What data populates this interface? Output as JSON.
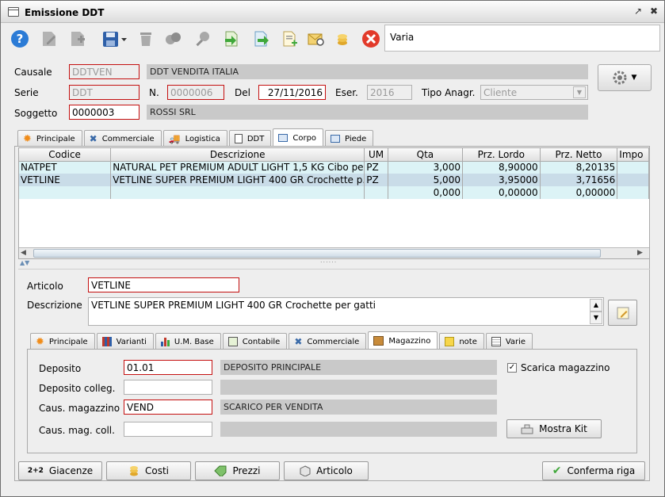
{
  "window": {
    "title": "Emissione DDT"
  },
  "toolbar": {
    "varia": "Varia"
  },
  "header": {
    "causale_label": "Causale",
    "causale_code": "DDTVEN",
    "causale_desc": "DDT VENDITA ITALIA",
    "serie_label": "Serie",
    "serie_value": "DDT",
    "n_label": "N.",
    "n_value": "0000006",
    "del_label": "Del",
    "del_value": "27/11/2016",
    "eser_label": "Eser.",
    "eser_value": "2016",
    "tipo_label": "Tipo Anagr.",
    "tipo_value": "Cliente",
    "soggetto_label": "Soggetto",
    "soggetto_code": "0000003",
    "soggetto_desc": "ROSSI SRL"
  },
  "main_tabs": [
    "Principale",
    "Commerciale",
    "Logistica",
    "DDT",
    "Corpo",
    "Piede"
  ],
  "grid": {
    "columns": [
      "Codice",
      "Descrizione",
      "UM",
      "Qta",
      "Prz. Lordo",
      "Prz. Netto",
      "Impo"
    ],
    "rows": [
      [
        "NATPET",
        "NATURAL PET PREMIUM ADULT LIGHT 1,5 KG Cibo pe...",
        "PZ",
        "3,000",
        "8,90000",
        "8,20135",
        ""
      ],
      [
        "VETLINE",
        "VETLINE SUPER PREMIUM LIGHT 400 GR Crochette p...",
        "PZ",
        "5,000",
        "3,95000",
        "3,71656",
        ""
      ],
      [
        "",
        "",
        "",
        "0,000",
        "0,00000",
        "0,00000",
        ""
      ]
    ]
  },
  "detail": {
    "articolo_label": "Articolo",
    "articolo_value": "VETLINE",
    "descrizione_label": "Descrizione",
    "descrizione_value": "VETLINE SUPER PREMIUM LIGHT 400 GR Crochette per gatti"
  },
  "sub_tabs": [
    "Principale",
    "Varianti",
    "U.M. Base",
    "Contabile",
    "Commerciale",
    "Magazzino",
    "note",
    "Varie"
  ],
  "magazzino": {
    "deposito_label": "Deposito",
    "deposito_code": "01.01",
    "deposito_desc": "DEPOSITO PRINCIPALE",
    "deposito_colleg_label": "Deposito colleg.",
    "deposito_colleg_code": "",
    "deposito_colleg_desc": "",
    "caus_mag_label": "Caus. magazzino",
    "caus_mag_code": "VEND",
    "caus_mag_desc": "SCARICO PER VENDITA",
    "caus_mag_coll_label": "Caus. mag. coll.",
    "caus_mag_coll_code": "",
    "caus_mag_coll_desc": "",
    "scarica_label": "Scarica magazzino",
    "scarica_checked": true,
    "mostra_kit_label": "Mostra Kit"
  },
  "bottom": {
    "giacenze_icon": "2+2",
    "giacenze": "Giacenze",
    "costi": "Costi",
    "prezzi": "Prezzi",
    "articolo": "Articolo",
    "conferma": "Conferma riga"
  },
  "colors": {
    "required_border": "#c41010",
    "row_light": "#dcf3f6",
    "row_selected": "#c9dce8",
    "gray_desc": "#c9c9c9"
  }
}
